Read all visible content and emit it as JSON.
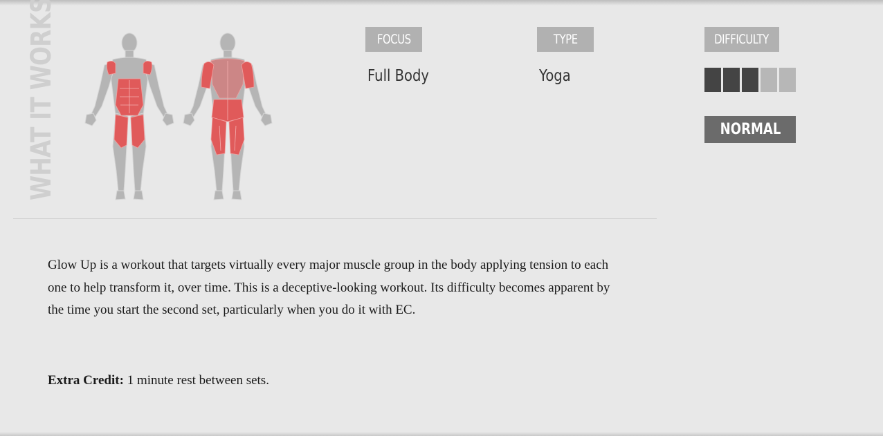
{
  "section_label": "WHAT IT WORKS",
  "figure": {
    "front_icon": "muscle-figure-front-icon",
    "back_icon": "muscle-figure-back-icon",
    "highlight_color": "#e05a5a",
    "body_color": "#b5b5b5"
  },
  "focus": {
    "label": "FOCUS",
    "value": "Full Body"
  },
  "type": {
    "label": "TYPE",
    "value": "Yoga"
  },
  "difficulty": {
    "label": "DIFFICULTY",
    "level": 3,
    "max": 5,
    "rating_text": "NORMAL"
  },
  "description": "Glow Up is a workout that targets virtually every major muscle group in the body applying tension to each one to help transform it, over time. This is a deceptive-looking workout. Its difficulty becomes apparent by the time you start the second set, particularly when you do it with EC.",
  "extra_credit": {
    "label": "Extra Credit:",
    "text": " 1 minute rest between sets."
  },
  "colors": {
    "background": "#e8e8e8",
    "tag_background": "#b1b1b1",
    "bar_active": "#444444",
    "bar_inactive": "#b7b7b7",
    "rating_background": "#6b6b6b"
  }
}
